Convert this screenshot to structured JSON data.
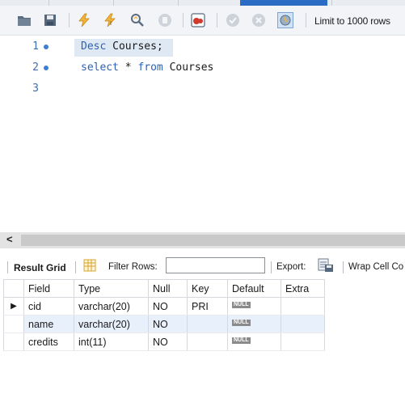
{
  "toolbar": {
    "limit_label": "Limit to 1000 rows",
    "icons": [
      "folder-icon",
      "save-icon",
      "execute-icon",
      "execute-current-icon",
      "explain-icon",
      "stop-icon",
      "toggle-error-icon",
      "commit-icon",
      "rollback-icon",
      "autocommit-icon"
    ]
  },
  "editor": {
    "lines": [
      {
        "number": "1",
        "keyword": "Desc",
        "rest": " Courses;"
      },
      {
        "number": "2",
        "keyword": "select",
        "middle": " * ",
        "keyword2": "from",
        "rest": " Courses"
      },
      {
        "number": "3"
      }
    ]
  },
  "result_toolbar": {
    "result_grid_label": "Result Grid",
    "filter_label": "Filter Rows:",
    "filter_value": "",
    "export_label": "Export:",
    "wrap_label": "Wrap Cell Co"
  },
  "grid": {
    "columns": [
      "Field",
      "Type",
      "Null",
      "Key",
      "Default",
      "Extra"
    ],
    "rows": [
      {
        "field": "cid",
        "type": "varchar(20)",
        "null": "NO",
        "key": "PRI",
        "default": "NULL",
        "extra": ""
      },
      {
        "field": "name",
        "type": "varchar(20)",
        "null": "NO",
        "key": "",
        "default": "NULL",
        "extra": ""
      },
      {
        "field": "credits",
        "type": "int(11)",
        "null": "NO",
        "key": "",
        "default": "NULL",
        "extra": ""
      }
    ],
    "current_row_marker": "▶"
  },
  "colors": {
    "keyword": "#2c62b5",
    "line_number": "#3a6fb0",
    "active_tab": "#2b6cc4",
    "row_alt": "#e8f0fb"
  }
}
